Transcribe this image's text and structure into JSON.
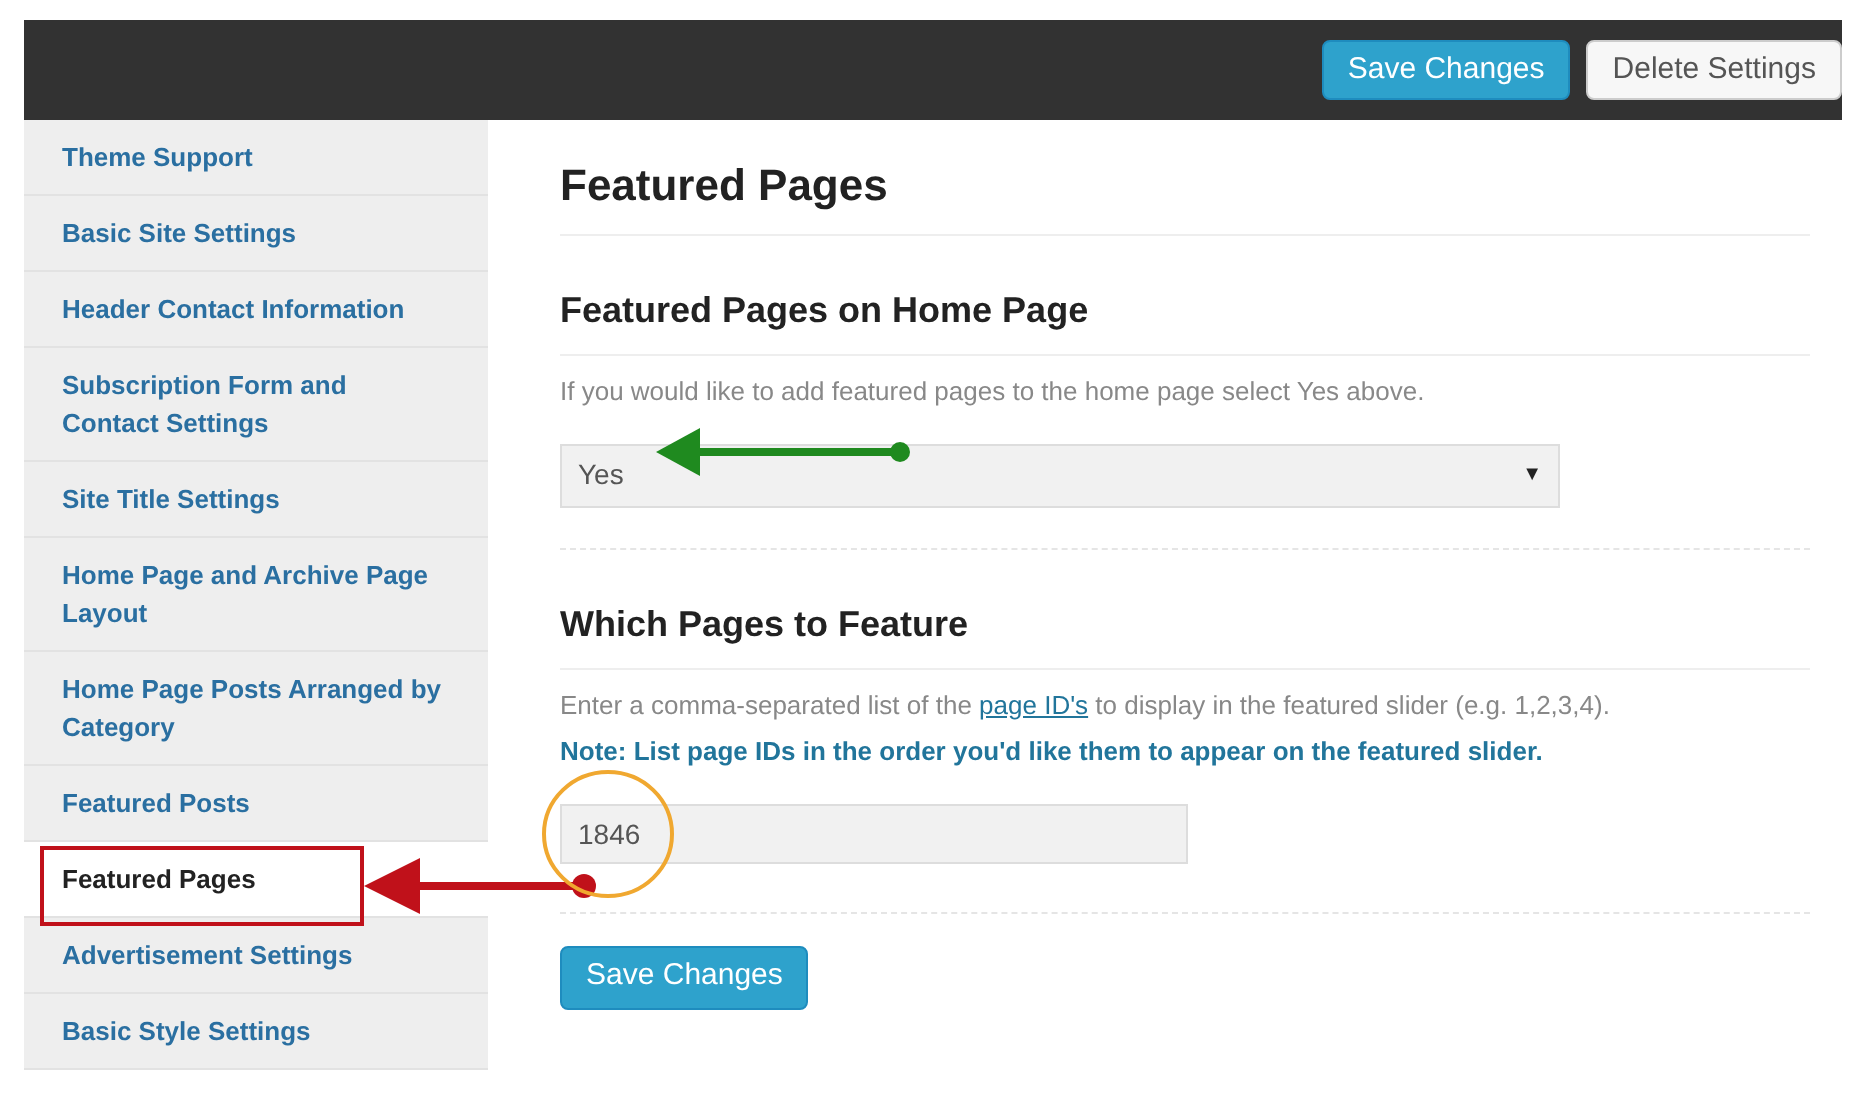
{
  "top_bar": {
    "buttons": [
      {
        "label": "Save Changes",
        "kind": "primary"
      },
      {
        "label": "Delete Settings",
        "kind": "secondary"
      }
    ]
  },
  "sidebar": {
    "items": [
      {
        "label": "Theme Support",
        "selected": false
      },
      {
        "label": "Basic Site Settings",
        "selected": false
      },
      {
        "label": "Header Contact Information",
        "selected": false
      },
      {
        "label": "Subscription Form and Contact Settings",
        "selected": false
      },
      {
        "label": "Site Title Settings",
        "selected": false
      },
      {
        "label": "Home Page and Archive Page Layout",
        "selected": false
      },
      {
        "label": "Home Page Posts Arranged by Category",
        "selected": false
      },
      {
        "label": "Featured Posts",
        "selected": false
      },
      {
        "label": "Featured Pages",
        "selected": true
      },
      {
        "label": "Advertisement Settings",
        "selected": false
      },
      {
        "label": "Basic Style Settings",
        "selected": false
      }
    ]
  },
  "content": {
    "title": "Featured Pages",
    "sections": [
      {
        "heading": "Featured Pages on Home Page",
        "help": "If you would like to add featured pages to the home page select Yes above.",
        "kind": "select",
        "value": "Yes",
        "arrow": "▼"
      },
      {
        "heading": "Which Pages to Feature",
        "help_before": "Enter a comma-separated list of the ",
        "help_link": "page ID's",
        "help_after": " to display in the featured slider (e.g. 1,2,3,4).",
        "note": "Note: List page IDs in the order you'd like them to appear on the featured slider.",
        "kind": "text",
        "value": "1846"
      }
    ],
    "save_button": "Save Changes"
  }
}
